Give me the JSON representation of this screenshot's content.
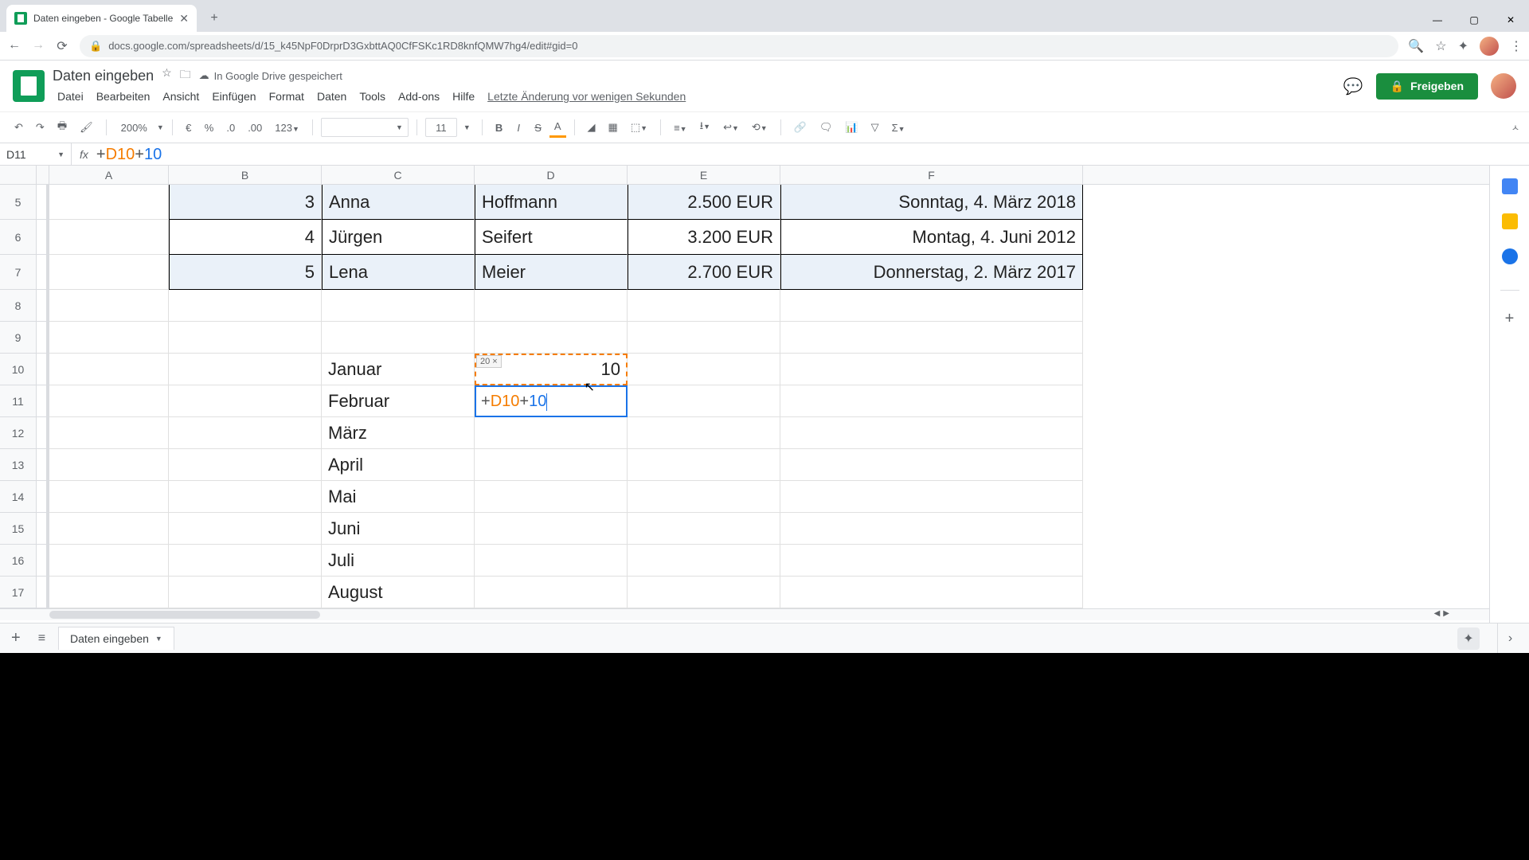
{
  "browser": {
    "tab_title": "Daten eingeben - Google Tabelle",
    "url": "docs.google.com/spreadsheets/d/15_k45NpF0DrprD3GxbttAQ0CfFSKc1RD8knfQMW7hg4/edit#gid=0"
  },
  "header": {
    "doc_title": "Daten eingeben",
    "cloud_status": "In Google Drive gespeichert",
    "menu": [
      "Datei",
      "Bearbeiten",
      "Ansicht",
      "Einfügen",
      "Format",
      "Daten",
      "Tools",
      "Add-ons",
      "Hilfe"
    ],
    "last_edit": "Letzte Änderung vor wenigen Sekunden",
    "share": "Freigeben"
  },
  "toolbar": {
    "zoom": "200%",
    "fmt_currency": "€",
    "fmt_percent": "%",
    "fmt_dec_dec": ".0",
    "fmt_dec_inc": ".00",
    "fmt_123": "123",
    "font": "",
    "font_size": "11"
  },
  "formula_bar": {
    "cell_ref": "D11",
    "formula_plus1": "+",
    "formula_ref": "D10",
    "formula_plus2": "+",
    "formula_num": "10"
  },
  "columns": [
    "A",
    "B",
    "C",
    "D",
    "E",
    "F"
  ],
  "rows": {
    "r5": {
      "n": "5",
      "B": "3",
      "C": "Anna",
      "D": "Hoffmann",
      "E": "2.500 EUR",
      "F": "Sonntag, 4. März 2018"
    },
    "r6": {
      "n": "6",
      "B": "4",
      "C": "Jürgen",
      "D": "Seifert",
      "E": "3.200 EUR",
      "F": "Montag, 4. Juni 2012"
    },
    "r7": {
      "n": "7",
      "B": "5",
      "C": "Lena",
      "D": "Meier",
      "E": "2.700 EUR",
      "F": "Donnerstag, 2. März 2017"
    },
    "r8": {
      "n": "8"
    },
    "r9": {
      "n": "9"
    },
    "r10": {
      "n": "10",
      "C": "Januar",
      "D": "10",
      "D_hint": "20 ×"
    },
    "r11": {
      "n": "11",
      "C": "Februar",
      "D_formula_p1": "+",
      "D_formula_ref": "D10",
      "D_formula_p2": "+",
      "D_formula_num": "10"
    },
    "r12": {
      "n": "12",
      "C": "März"
    },
    "r13": {
      "n": "13",
      "C": "April"
    },
    "r14": {
      "n": "14",
      "C": "Mai"
    },
    "r15": {
      "n": "15",
      "C": "Juni"
    },
    "r16": {
      "n": "16",
      "C": "Juli"
    },
    "r17": {
      "n": "17",
      "C": "August"
    }
  },
  "sheet_tab": "Daten eingeben"
}
